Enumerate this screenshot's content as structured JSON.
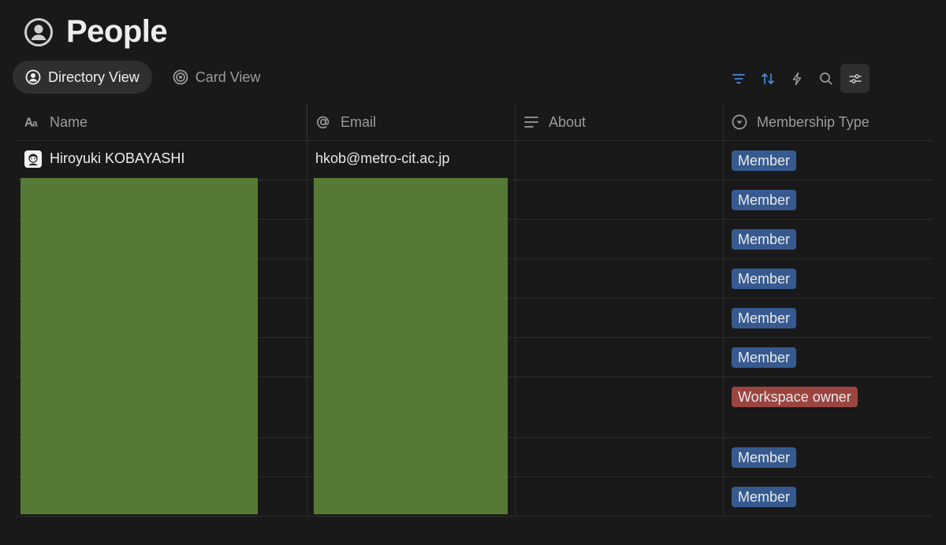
{
  "page": {
    "title": "People",
    "icon": "person-circle-icon"
  },
  "views": [
    {
      "label": "Directory View",
      "icon": "person-circle-icon",
      "active": true
    },
    {
      "label": "Card View",
      "icon": "target-icon",
      "active": false
    }
  ],
  "toolbar": {
    "buttons": [
      {
        "name": "filter",
        "icon": "filter-icon",
        "color": "#4a8bd6"
      },
      {
        "name": "sort",
        "icon": "sort-icon",
        "color": "#4a8bd6"
      },
      {
        "name": "automation",
        "icon": "lightning-icon",
        "color": "#9b9b9b"
      },
      {
        "name": "search",
        "icon": "search-icon",
        "color": "#9b9b9b"
      },
      {
        "name": "settings",
        "icon": "sliders-icon",
        "color": "#c8c8c8"
      }
    ]
  },
  "table": {
    "columns": [
      {
        "label": "Name",
        "icon": "text-aa-icon"
      },
      {
        "label": "Email",
        "icon": "at-icon"
      },
      {
        "label": "About",
        "icon": "text-lines-icon"
      },
      {
        "label": "Membership Type",
        "icon": "select-circle-icon"
      }
    ],
    "rows": [
      {
        "name": "Hiroyuki KOBAYASHI",
        "email": "hkob@metro-cit.ac.jp",
        "about": "",
        "type": "Member",
        "type_kind": "member",
        "redacted": false
      },
      {
        "name": "",
        "email": "",
        "about": "",
        "type": "Member",
        "type_kind": "member",
        "redacted": true
      },
      {
        "name": "",
        "email": "",
        "about": "",
        "type": "Member",
        "type_kind": "member",
        "redacted": true
      },
      {
        "name": "",
        "email": "",
        "about": "",
        "type": "Member",
        "type_kind": "member",
        "redacted": true
      },
      {
        "name": "",
        "email": "",
        "about": "",
        "type": "Member",
        "type_kind": "member",
        "redacted": true
      },
      {
        "name": "",
        "email": "",
        "about": "",
        "type": "Member",
        "type_kind": "member",
        "redacted": true
      },
      {
        "name": "",
        "email": "",
        "about": "",
        "type": "Workspace owner",
        "type_kind": "owner",
        "redacted": true
      },
      {
        "name": "",
        "email": "",
        "about": "",
        "type": "Member",
        "type_kind": "member",
        "redacted": true
      },
      {
        "name": "",
        "email": "",
        "about": "",
        "type": "Member",
        "type_kind": "member",
        "redacted": true
      }
    ]
  },
  "colors": {
    "background": "#191919",
    "member_badge": "#365a8f",
    "owner_badge": "#9b4440",
    "redaction": "#567a35",
    "accent_blue": "#4a8bd6"
  }
}
